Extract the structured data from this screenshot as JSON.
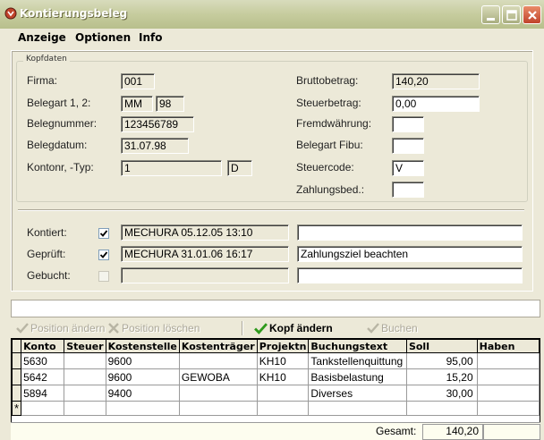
{
  "window": {
    "title": "Kontierungsbeleg",
    "accent": "#c0432b"
  },
  "menu": [
    "Anzeige",
    "Optionen",
    "Info"
  ],
  "kopfdaten": {
    "legend": "Kopfdaten",
    "firma_label": "Firma:",
    "firma": "001",
    "belegart_label": "Belegart 1, 2:",
    "belegart1": "MM",
    "belegart2": "98",
    "belegnummer_label": "Belegnummer:",
    "belegnummer": "123456789",
    "belegdatum_label": "Belegdatum:",
    "belegdatum": "31.07.98",
    "kontonr_label": "Kontonr, -Typ:",
    "kontonr": "1",
    "kontotyp": "D",
    "brutto_label": "Bruttobetrag:",
    "brutto": "140,20",
    "steuer_label": "Steuerbetrag:",
    "steuer": "0,00",
    "fremd_label": "Fremdwährung:",
    "fremd": "",
    "belegartfibu_label": "Belegart Fibu:",
    "belegartfibu": "",
    "steuercode_label": "Steuercode:",
    "steuercode": "V",
    "zahlungsbed_label": "Zahlungsbed.:",
    "zahlungsbed": ""
  },
  "status": {
    "kontiert_label": "Kontiert:",
    "kontiert_checked": true,
    "kontiert_info": "MECHURA  05.12.05  13:10",
    "kontiert_note": "",
    "geprueft_label": "Geprüft:",
    "geprueft_checked": true,
    "geprueft_info": "MECHURA  31.01.06  16:17",
    "geprueft_note": "Zahlungsziel beachten",
    "gebucht_label": "Gebucht:",
    "gebucht_checked": false,
    "gebucht_info": "",
    "gebucht_note": ""
  },
  "toolbar": {
    "position_aendern": "Position ändern",
    "position_loeschen": "Position löschen",
    "kopf_aendern": "Kopf ändern",
    "buchen": "Buchen"
  },
  "grid": {
    "columns": [
      "Konto",
      "Steuer",
      "Kostenstelle",
      "Kostenträger",
      "Projektn",
      "Buchungstext",
      "Soll",
      "Haben"
    ],
    "rows": [
      [
        "5630",
        "",
        "9600",
        "",
        "KH10",
        "Tankstellenquittung",
        "95,00",
        ""
      ],
      [
        "5642",
        "",
        "9600",
        "GEWOBA",
        "KH10",
        "Basisbelastung",
        "15,20",
        ""
      ],
      [
        "5894",
        "",
        "9400",
        "",
        "",
        "Diverses",
        "30,00",
        ""
      ]
    ],
    "new_row_marker": "*"
  },
  "footer": {
    "gesamt_label": "Gesamt:",
    "gesamt_value": "140,20"
  }
}
